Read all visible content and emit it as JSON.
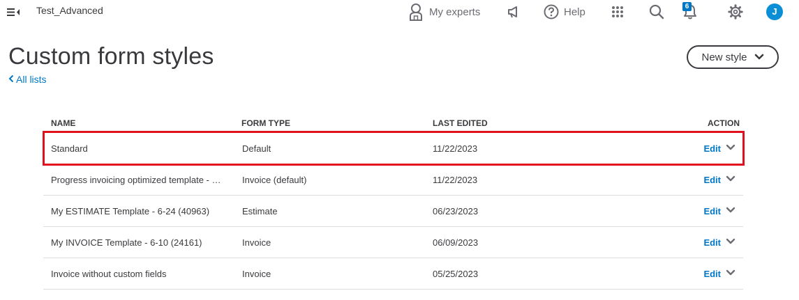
{
  "topbar": {
    "company_name": "Test_Advanced",
    "experts_label": "My experts",
    "help_label": "Help",
    "notification_count": "6",
    "avatar_initial": "J"
  },
  "header": {
    "title": "Custom form styles",
    "back_link": "All lists",
    "new_style_button": "New style"
  },
  "table": {
    "columns": [
      "NAME",
      "FORM TYPE",
      "LAST EDITED",
      "ACTION"
    ],
    "rows": [
      {
        "name": "Standard",
        "form_type": "Default",
        "last_edited": "11/22/2023",
        "action": "Edit"
      },
      {
        "name": "Progress invoicing optimized template - …",
        "form_type": "Invoice (default)",
        "last_edited": "11/22/2023",
        "action": "Edit"
      },
      {
        "name": "My ESTIMATE Template - 6-24 (40963)",
        "form_type": "Estimate",
        "last_edited": "06/23/2023",
        "action": "Edit"
      },
      {
        "name": "My INVOICE Template - 6-10 (24161)",
        "form_type": "Invoice",
        "last_edited": "06/09/2023",
        "action": "Edit"
      },
      {
        "name": "Invoice without custom fields",
        "form_type": "Invoice",
        "last_edited": "05/25/2023",
        "action": "Edit"
      }
    ]
  },
  "colors": {
    "accent": "#0077c5",
    "highlight_border": "#e1101f",
    "text": "#393a3d"
  }
}
